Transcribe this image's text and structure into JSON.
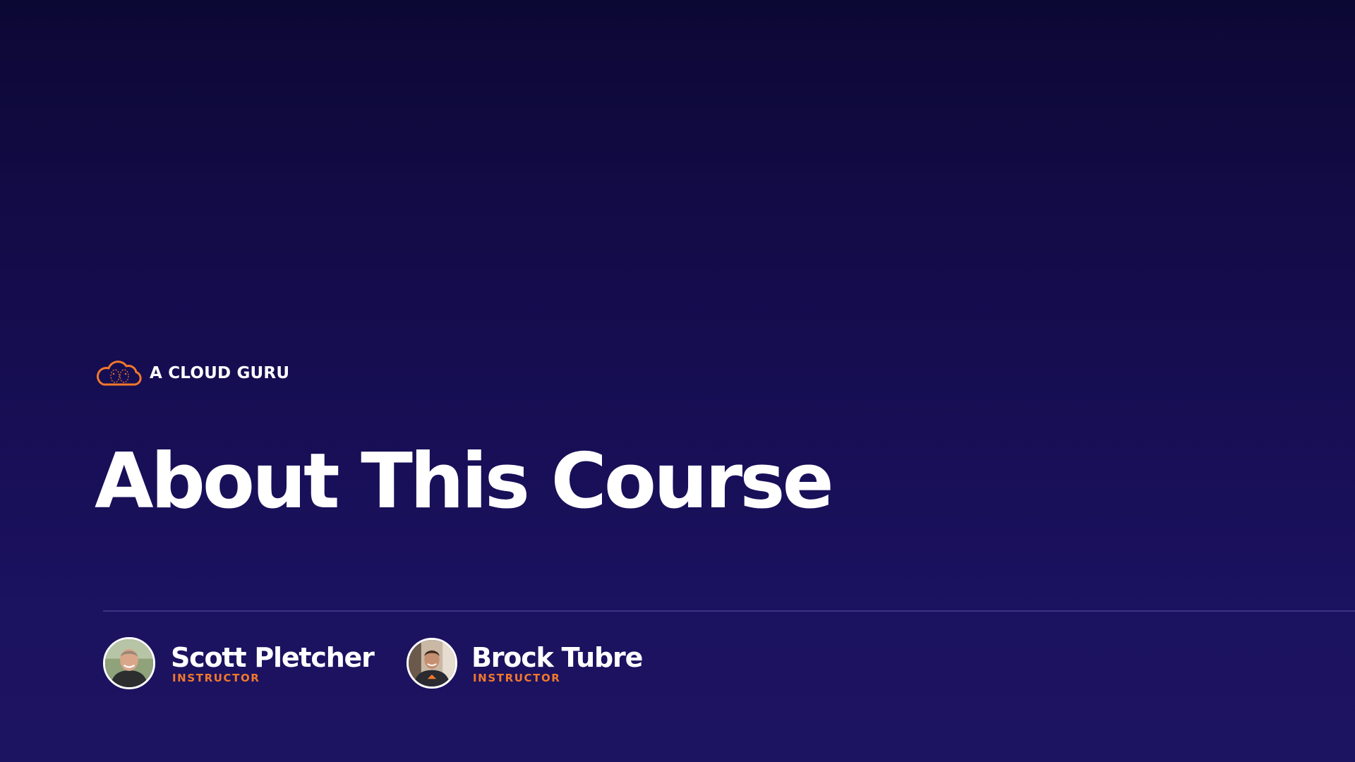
{
  "brand": {
    "name": "A CLOUD GURU",
    "logo_icon": "cloud-logo-icon",
    "accent_color": "#f2782a"
  },
  "slide": {
    "title": "About This Course",
    "background_color": "#170e55"
  },
  "instructors": [
    {
      "name": "Scott Pletcher",
      "role": "INSTRUCTOR",
      "avatar": "avatar-photo"
    },
    {
      "name": "Brock Tubre",
      "role": "INSTRUCTOR",
      "avatar": "avatar-photo"
    }
  ]
}
